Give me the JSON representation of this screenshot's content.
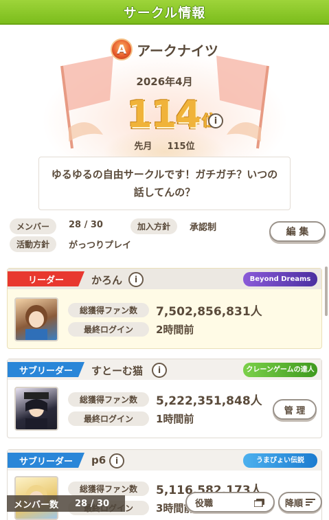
{
  "header": {
    "title": "サークル情報"
  },
  "circle": {
    "badge_letter": "A",
    "name": "アークナイツ",
    "month": "2026年4月",
    "rank_number": "114",
    "rank_unit": "位",
    "info_glyph": "i",
    "prev_label": "先月",
    "prev_value": "115位",
    "description": "ゆるゆるの自由サークルです！ガチガチ？いつの話してんの？"
  },
  "meta": {
    "members_label": "メンバー",
    "members_value": "28 / 30",
    "join_label": "加入方針",
    "join_value": "承認制",
    "activity_label": "活動方針",
    "activity_value": "がっつりプレイ",
    "edit_button": "編 集"
  },
  "members": [
    {
      "role": "リーダー",
      "role_color": "#e8382f",
      "name": "かろん",
      "title_badge": "Beyond Dreams",
      "badge_color": "#6a3fb8",
      "fans_label": "総獲得ファン数",
      "fans_value": "7,502,856,831人",
      "login_label": "最終ログイン",
      "login_value": "2時間前"
    },
    {
      "role": "サブリーダー",
      "role_color": "#2a86d8",
      "name": "すとーむ猫",
      "title_badge": "クレーンゲームの達人",
      "badge_color": "#5db82a",
      "fans_label": "総獲得ファン数",
      "fans_value": "5,222,351,848人",
      "login_label": "最終ログイン",
      "login_value": "1時間前",
      "manage_button": "管 理"
    },
    {
      "role": "サブリーダー",
      "role_color": "#2a86d8",
      "name": "p6",
      "title_badge": "うまぴょい伝説",
      "badge_color": "#2b8fd9",
      "fans_label": "総獲得ファン数",
      "fans_value": "5,116,582,173人",
      "login_label": "最終ログイン",
      "login_value": "3時間前"
    }
  ],
  "footer": {
    "count_label": "メンバー数",
    "count_value": "28 / 30",
    "filter_label": "役職",
    "sort_label": "降順"
  },
  "colors": {
    "header_green": "#7cbd1c",
    "leader_bg": "#fffbe6",
    "rank_gold": "#f0b33a"
  }
}
